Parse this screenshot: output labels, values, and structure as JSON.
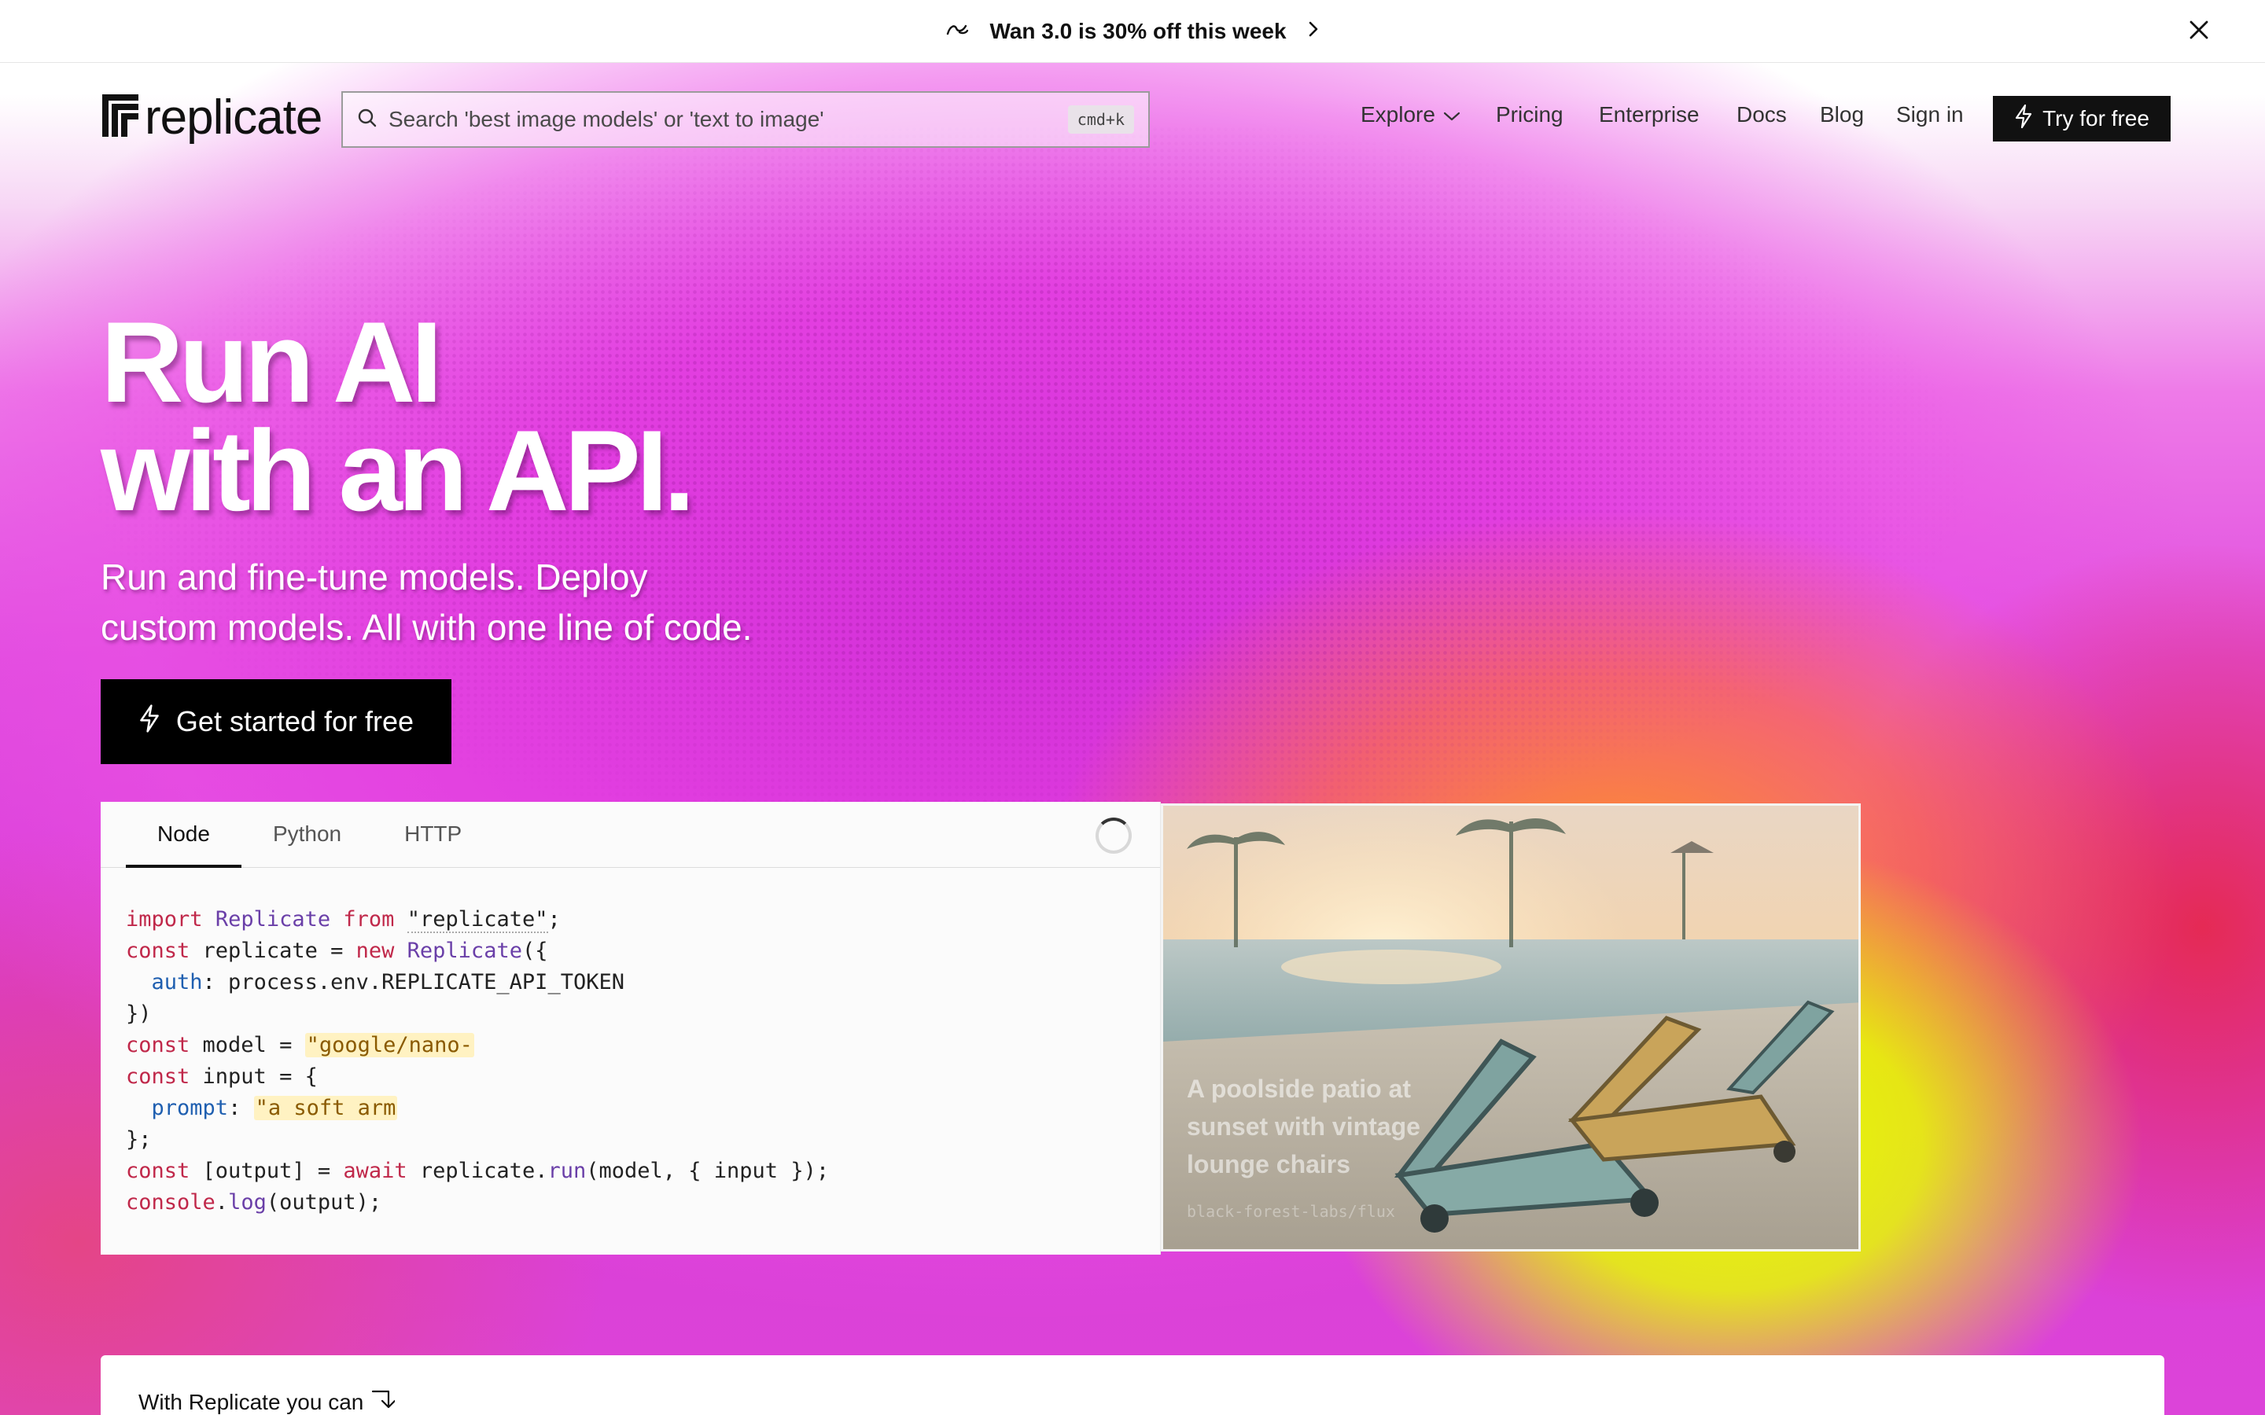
{
  "announcement": {
    "text": "Wan 3.0 is 30% off this week"
  },
  "header": {
    "logo_text": "replicate",
    "search_placeholder": "Search 'best image models' or 'text to image'",
    "search_shortcut": "cmd+k",
    "nav": {
      "explore": "Explore",
      "pricing": "Pricing",
      "enterprise": "Enterprise",
      "docs": "Docs",
      "blog": "Blog",
      "sign_in": "Sign in",
      "try_free": "Try for free"
    }
  },
  "hero": {
    "title_line1": "Run AI",
    "title_line2": "with an API.",
    "subtitle_line1": "Run and fine-tune models. Deploy",
    "subtitle_line2": "custom models. All with one line of code.",
    "cta": "Get started for free"
  },
  "code_panel": {
    "tabs": [
      "Node",
      "Python",
      "HTTP"
    ],
    "active_tab": "Node",
    "model_string": "\"google/nano-",
    "prompt_string": "\"a soft arm"
  },
  "image_panel": {
    "caption": "A poolside patio at sunset with vintage lounge chairs",
    "model": "black-forest-labs/flux"
  },
  "bottom": {
    "text": "With Replicate you can"
  },
  "colors": {
    "brand_black": "#111111",
    "hero_magenta": "#d93ad6",
    "hero_yellow": "#e6ff00",
    "keyword_red": "#c0284a",
    "class_purple": "#6a3fa8"
  }
}
